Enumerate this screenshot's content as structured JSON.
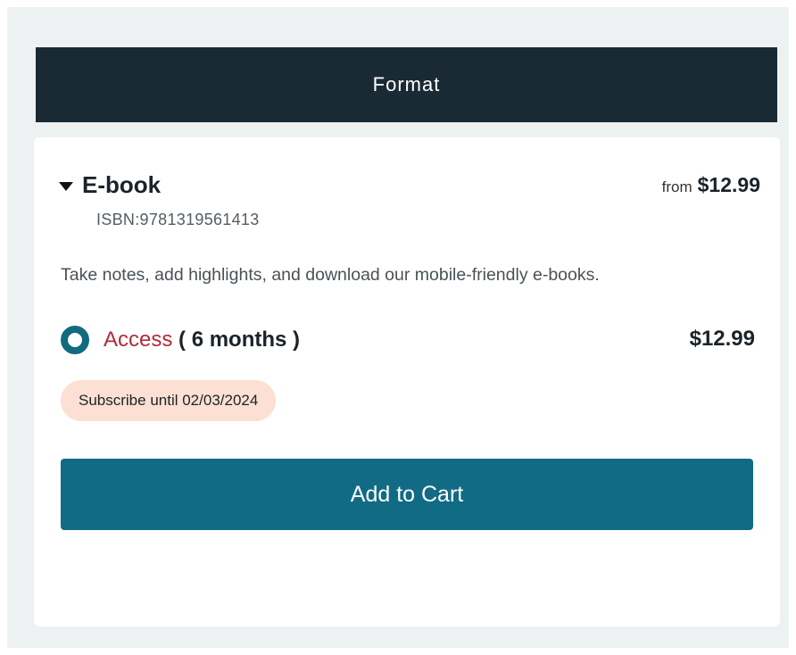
{
  "header": {
    "title": "Format"
  },
  "format": {
    "name": "E-book",
    "from_label": "from",
    "from_price": "$12.99",
    "isbn": "ISBN:9781319561413",
    "description": "Take notes, add highlights, and download our mobile-friendly e-books."
  },
  "option": {
    "name": "Access",
    "duration": " ( 6 months )",
    "price": "$12.99",
    "selected": true
  },
  "subscription": {
    "label": "Subscribe until 02/03/2024"
  },
  "cart": {
    "button_label": "Add to Cart"
  },
  "colors": {
    "header_bg": "#1a2a34",
    "accent": "#116b84",
    "option_name": "#b22b3a",
    "badge_bg": "#fbe0d3"
  },
  "icons": {
    "toggle": "caret-down-icon",
    "radio": "radio-selected-icon"
  }
}
